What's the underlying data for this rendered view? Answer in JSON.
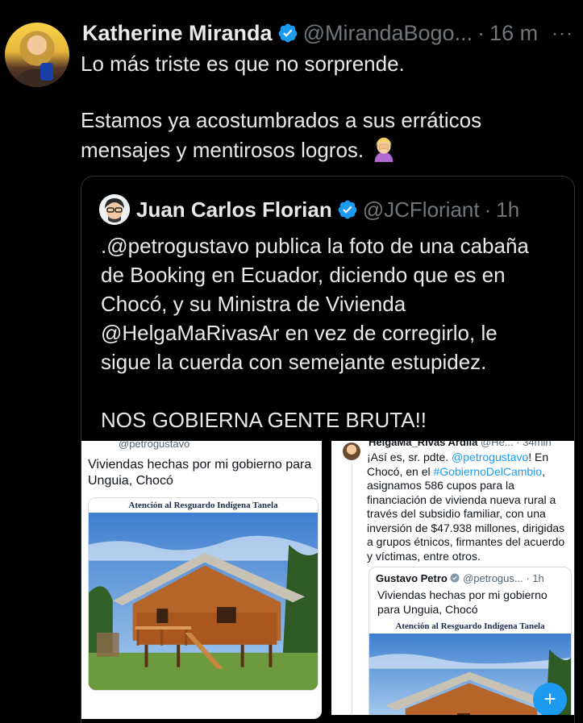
{
  "tweet": {
    "display_name": "Katherine Miranda",
    "handle": "@MirandaBogo...",
    "separator": "·",
    "time": "16 m",
    "more_icon": "···",
    "line1": "Lo más triste es que no sorprende.",
    "line2": "Estamos ya acostumbrados a sus erráticos",
    "line3": "mensajes y mentirosos logros.",
    "emoji": "facepalm-emoji"
  },
  "quote": {
    "display_name": "Juan Carlos Florian",
    "handle": "@JCFloriant",
    "separator": "·",
    "time": "1h",
    "lines": [
      ".@petrogustavo publica la foto de una cabaña",
      "de Booking en Ecuador, diciendo que es en",
      "Chocó, y su Ministra de Vivienda",
      "@HelgaMaRivasAr en vez de corregirlo, le",
      "sigue la cuerda con semejante estupidez."
    ],
    "shout": "NOS GOBIERNA GENTE BRUTA!!"
  },
  "screenshot1": {
    "handle": "@petrogustavo",
    "text": "Viviendas hechas por mi gobierno para Unguia, Chocó",
    "banner": "Atención al Resguardo Indígena Tanela"
  },
  "screenshot2": {
    "name": "HelgaMa_Rivas Ardila",
    "meta": "@He... · 34min",
    "text_part1": "¡Así es, sr. pdte. ",
    "mention": "@petrogustavo",
    "text_part2": "! En Chocó, en el ",
    "hashtag": "#GobiernoDelCambio",
    "text_part3": ", asignamos 586 cupos para la financiación de vivienda nueva rural a través del subsidio familiar, con una inversión de $47.938 millones, dirigidas a grupos étnicos, firmantes del acuerdo y víctimas, entre otros.",
    "inner_name": "Gustavo Petro",
    "inner_meta": "@petrogus... · 1h",
    "inner_text": "Viviendas hechas por mi gobierno para Unguia, Chocó",
    "inner_banner": "Atención al Resguardo Indígena Tanela",
    "fab_label": "+"
  },
  "colors": {
    "background": "#000000",
    "text": "#e7e9ea",
    "muted": "#71767b",
    "verified": "#1d9bf0",
    "border": "#2f3336"
  }
}
